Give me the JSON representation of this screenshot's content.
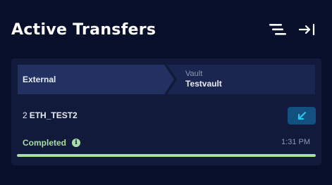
{
  "header": {
    "title": "Active Transfers",
    "icons": [
      "filter-list-icon",
      "collapse-panel-icon"
    ]
  },
  "transfer": {
    "source": {
      "label": "External"
    },
    "destination": {
      "caption": "Vault",
      "name": "Testvault"
    },
    "amount": "2",
    "asset": "ETH_TEST2",
    "direction_icon": "incoming-arrow-icon",
    "status": "Completed",
    "time": "1:31 PM",
    "progress": 1.0
  },
  "colors": {
    "background": "#070f2b",
    "card": "#111a3b",
    "source_segment": "#223062",
    "destination_segment": "#1a2550",
    "accent": "#26c6f0",
    "incoming_button": "#125080",
    "success": "#a7dfa7"
  }
}
